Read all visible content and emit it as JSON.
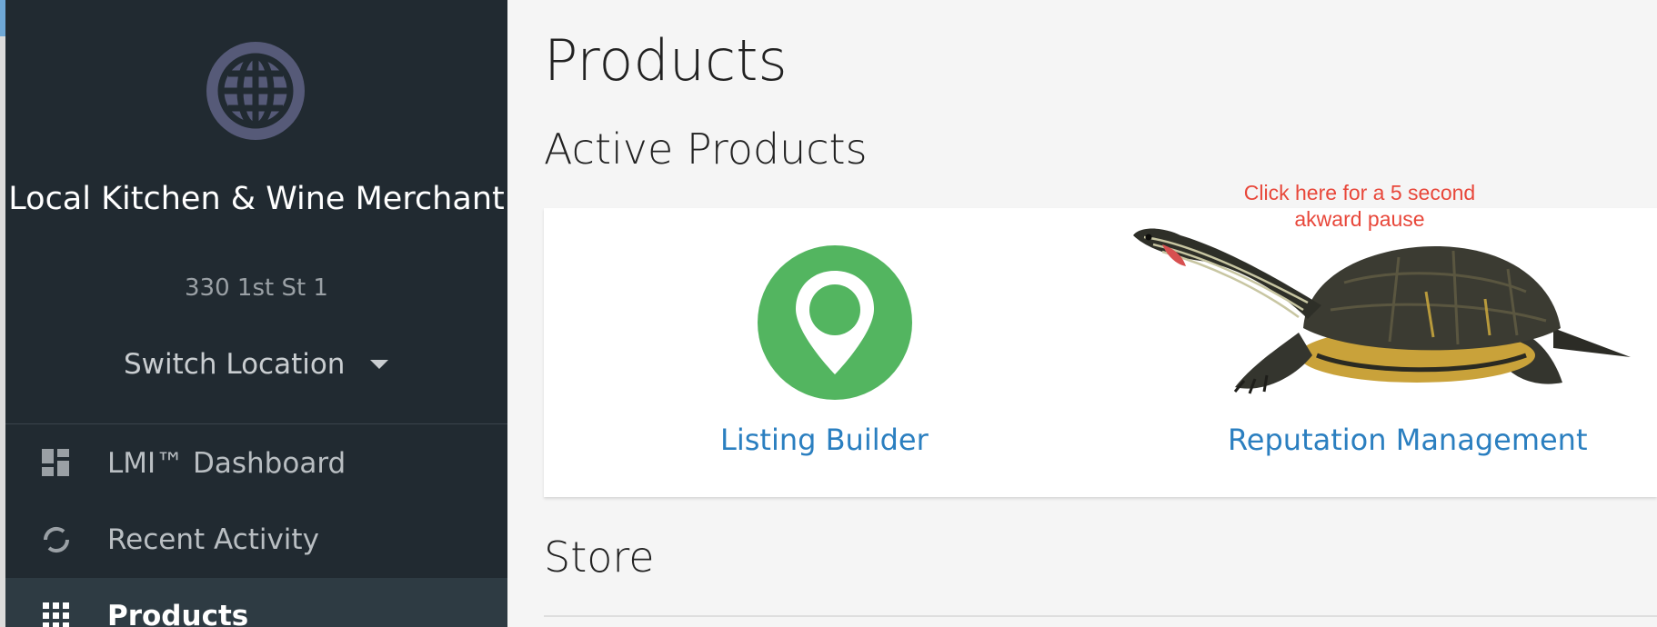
{
  "sidebar": {
    "business_name": "Local Kitchen & Wine Merchant",
    "address": "330 1st St 1",
    "switch_location_label": "Switch Location",
    "logo_icon": "globe-icon",
    "nav": [
      {
        "label": "LMI™ Dashboard",
        "icon": "dashboard-icon",
        "active": false
      },
      {
        "label": "Recent Activity",
        "icon": "activity-icon",
        "active": false
      },
      {
        "label": "Products",
        "icon": "grid-icon",
        "active": true
      }
    ]
  },
  "main": {
    "title": "Products",
    "active_products_heading": "Active Products",
    "store_heading": "Store",
    "products": [
      {
        "label": "Listing Builder",
        "icon": "map-pin-icon"
      },
      {
        "label": "Reputation Management",
        "icon": "turtle-image"
      }
    ],
    "annotation": "Click here for a 5 second akward pause"
  },
  "colors": {
    "sidebar_bg": "#212a31",
    "sidebar_active_bg": "#2e3b43",
    "globe": "#565a78",
    "pin_green": "#53b560",
    "link_blue": "#2b7fc0",
    "annotation_red": "#e8473a"
  }
}
